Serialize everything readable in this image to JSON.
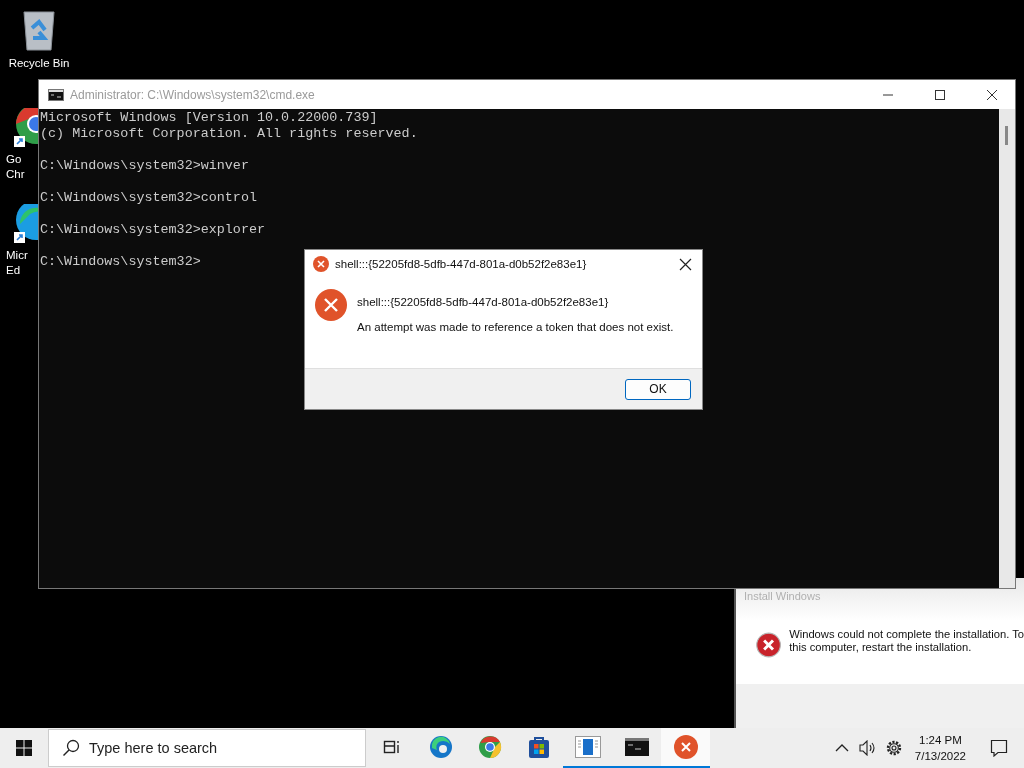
{
  "desktop_icons": [
    {
      "kind": "recycle",
      "label_lines": [
        "Recycle Bin"
      ]
    },
    {
      "kind": "chrome",
      "label_lines": [
        "Go",
        "Chr"
      ]
    },
    {
      "kind": "edge",
      "label_lines": [
        "Micr",
        "Ed"
      ]
    }
  ],
  "console_window": {
    "title": "Administrator: C:\\Windows\\system32\\cmd.exe",
    "blocks": [
      [
        "Microsoft Windows [Version 10.0.22000.739]",
        "(c) Microsoft Corporation. All rights reserved."
      ],
      [
        "C:\\Windows\\system32>winver"
      ],
      [
        "C:\\Windows\\system32>control"
      ],
      [
        "C:\\Windows\\system32>explorer"
      ],
      [
        "C:\\Windows\\system32>"
      ]
    ]
  },
  "error_dialog": {
    "title": "shell:::{52205fd8-5dfb-447d-801a-d0b52f2e83e1}",
    "heading": "shell:::{52205fd8-5dfb-447d-801a-d0b52f2e83e1}",
    "message": "An attempt was made to reference a token that does not exist.",
    "button": "OK"
  },
  "install_window": {
    "title": "Install Windows",
    "message_lines": [
      "Windows could not complete the installation. To",
      "this computer, restart the installation."
    ]
  },
  "taskbar": {
    "search": {
      "placeholder": "Type here to search"
    },
    "apps": [
      {
        "kind": "taskview",
        "running": false,
        "active": false
      },
      {
        "kind": "edge",
        "running": false,
        "active": false
      },
      {
        "kind": "chrome",
        "running": false,
        "active": false
      },
      {
        "kind": "store",
        "running": false,
        "active": false
      },
      {
        "kind": "setup",
        "running": true,
        "active": false
      },
      {
        "kind": "console",
        "running": true,
        "active": false
      },
      {
        "kind": "error",
        "running": true,
        "active": true
      }
    ],
    "time": "1:24 PM",
    "date": "7/13/2022"
  }
}
